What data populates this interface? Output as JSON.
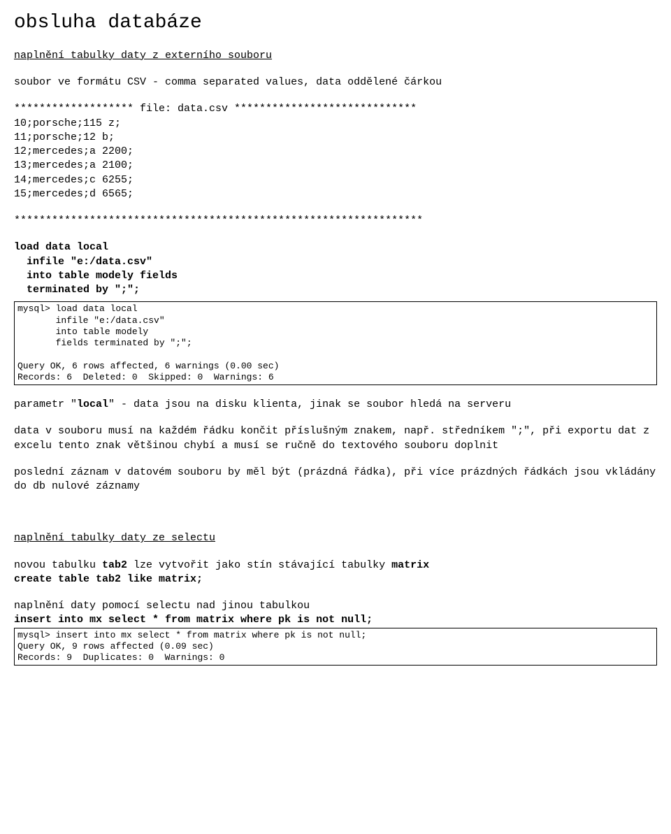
{
  "title": "obsluha databáze",
  "section1_heading": "naplnění tabulky daty z externího souboru",
  "csv_intro": "soubor ve formátu CSV - comma separated values, data oddělené čárkou",
  "file_header": "******************* file: data.csv *****************************",
  "csv_lines": "10;porsche;115 z;\n11;porsche;12 b;\n12;mercedes;a 2200;\n13;mercedes;a 2100;\n14;mercedes;c 6255;\n15;mercedes;d 6565;",
  "star_sep": "*****************************************************************",
  "load_cmd": "load data local\n  infile \"e:/data.csv\"\n  into table modely fields\n  terminated by \";\";",
  "box1": "mysql> load data local\n       infile \"e:/data.csv\"\n       into table modely\n       fields terminated by \";\";\n\nQuery OK, 6 rows affected, 6 warnings (0.00 sec)\nRecords: 6  Deleted: 0  Skipped: 0  Warnings: 6",
  "local_para_pre": "parametr \"",
  "local_word": "local",
  "local_para_post": "\" - data jsou na disku klienta, jinak se soubor hledá na serveru",
  "para2": "data v souboru musí na každém řádku končit příslušným znakem, např. středníkem \";\", při exportu dat z excelu tento znak většinou chybí a musí se ručně do textového souboru doplnit",
  "para3": "poslední záznam v datovém souboru by měl být (prázdná řádka), při více prázdných řádkách jsou vkládány do db nulové záznamy",
  "section2_heading": "naplnění tabulky daty ze selectu",
  "tab2_pre": "novou tabulku ",
  "tab2_b1": "tab2",
  "tab2_mid": " lze vytvořit jako stín stávající tabulky ",
  "tab2_b2": "matrix",
  "create_cmd": "create table tab2 like matrix;",
  "select_intro": "naplnění daty pomocí selectu nad jinou tabulkou",
  "insert_cmd": "insert into mx select * from matrix where pk is not null;",
  "box2": "mysql> insert into mx select * from matrix where pk is not null;\nQuery OK, 9 rows affected (0.09 sec)\nRecords: 9  Duplicates: 0  Warnings: 0"
}
